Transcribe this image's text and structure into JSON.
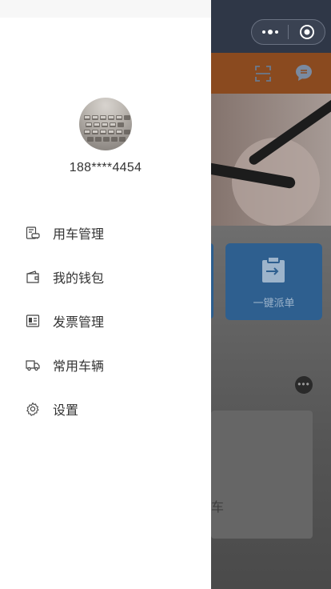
{
  "background": {
    "card_label": "一键派单",
    "panel_text": "车"
  },
  "user": {
    "phone": "188****4454"
  },
  "menu": {
    "items": [
      {
        "label": "用车管理",
        "icon": "car-manage-icon"
      },
      {
        "label": "我的钱包",
        "icon": "wallet-icon"
      },
      {
        "label": "发票管理",
        "icon": "invoice-icon"
      },
      {
        "label": "常用车辆",
        "icon": "truck-icon"
      },
      {
        "label": "设置",
        "icon": "gear-icon"
      }
    ]
  },
  "colors": {
    "nav": "#2f3747",
    "accent_orange": "#8a4a1f",
    "card_blue": "#2e5f8f",
    "drawer_bg": "#ffffff",
    "text": "#333333"
  }
}
